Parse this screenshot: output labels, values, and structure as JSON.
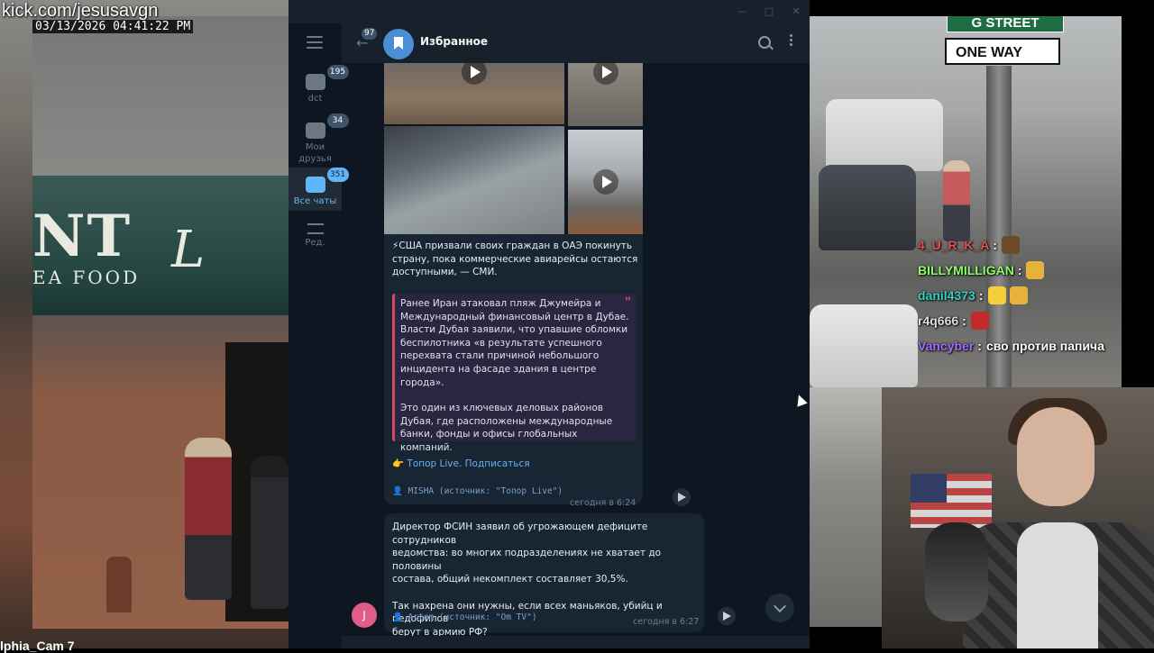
{
  "stream": {
    "url": "kick.com/jesusavgn",
    "timestamp": "03/13/2026 04:41:22 PM",
    "camera_caption": "lphia_Cam 7",
    "storefront_sign": "NT",
    "storefront_sub": "EA FOOD",
    "storefront_logo": "L",
    "street_sign": "G STREET",
    "oneway_sign": "ONE WAY"
  },
  "chat": [
    {
      "user": "4_U_R_K_A",
      "color": "#e05353",
      "message": "",
      "emotes": [
        "#6b4a2c"
      ]
    },
    {
      "user": "BILLYMILLIGAN",
      "color": "#8cff6a",
      "message": "",
      "emotes": [
        "#e6b23c"
      ]
    },
    {
      "user": "danil4373",
      "color": "#35d2c4",
      "message": "",
      "emotes": [
        "#f3cf3a",
        "#e6b23c"
      ]
    },
    {
      "user": "r4q666",
      "color": "#dddddd",
      "message": "",
      "emotes": [
        "#c52a2a"
      ]
    },
    {
      "user": "Vancyber",
      "color": "#a46cff",
      "message": "сво против папича",
      "emotes": []
    }
  ],
  "telegram": {
    "chat_title": "Избранное",
    "back_unread": "97",
    "folders": [
      {
        "label": "dct",
        "badge": "195"
      },
      {
        "label": "Мои друзья",
        "badge": "34"
      },
      {
        "label": "Все чаты",
        "badge": "351"
      },
      {
        "label": "Ред.",
        "badge": ""
      }
    ],
    "message1": {
      "lines": [
        "⚡США призвали своих граждан в ОАЭ покинуть",
        "страну, пока коммерческие авиарейсы остаются",
        "доступными, — СМИ."
      ],
      "quote_p1": [
        "Ранее Иран атаковал пляж Джумейра и",
        "Международный финансовый центр в Дубае.",
        "Власти Дубая заявили, что упавшие обломки",
        "беспилотника «в результате успешного",
        "перехвата стали причиной небольшого",
        "инцидента на фасаде здания в центре",
        "города»."
      ],
      "quote_p2": [
        "Это один из ключевых деловых районов",
        "Дубая, где расположены международные",
        "банки, фонды и офисы глобальных компаний."
      ],
      "subscribe": "👉 Топор Live. Подписаться",
      "signature": "👤 MISHA (источник: \"Топор Live\")",
      "time": "сегодня в 6:24"
    },
    "message2": {
      "p1": [
        "Директор ФСИН заявил об угрожающем дефиците сотрудников",
        "ведомства: во многих подразделениях не хватает до половины",
        "состава, общий некомплект составляет 30,5%."
      ],
      "p2": [
        "Так нахрена они нужны, если всех маньяков, убийц и педофилов",
        "берут в армию РФ?"
      ],
      "signature": "👤 Artem (источник: \"Om TV\")",
      "time": "сегодня в 6:27",
      "avatar_letter": "J"
    }
  }
}
